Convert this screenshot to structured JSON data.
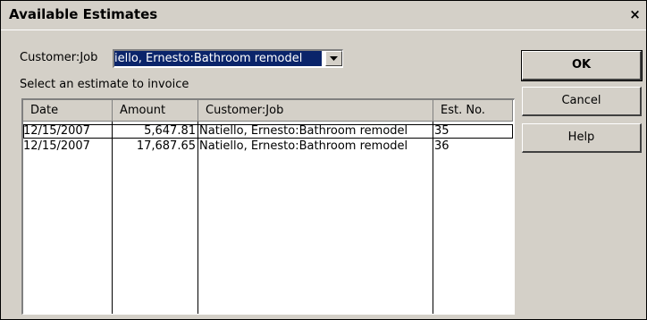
{
  "window": {
    "title": "Available Estimates",
    "close_glyph": "×"
  },
  "customer_job": {
    "label_prefix": "Customer:",
    "label_mnemonic": "J",
    "label_suffix": "ob",
    "value_visible": "iello, Ernesto:Bathroom remodel"
  },
  "instruction": "Select an estimate to invoice",
  "table": {
    "columns": [
      "Date",
      "Amount",
      "Customer:Job",
      "Est. No."
    ],
    "rows": [
      {
        "date": "12/15/2007",
        "amount": "5,647.81",
        "customer_job": "Natiello, Ernesto:Bathroom remodel",
        "est_no": "35"
      },
      {
        "date": "12/15/2007",
        "amount": "17,687.65",
        "customer_job": "Natiello, Ernesto:Bathroom remodel",
        "est_no": "36"
      }
    ]
  },
  "buttons": {
    "ok": "OK",
    "cancel": "Cancel",
    "help": "Help"
  },
  "colors": {
    "dialog_bg": "#d4d0c8",
    "selection_bg": "#0a246a",
    "selection_text": "#ffffff"
  }
}
